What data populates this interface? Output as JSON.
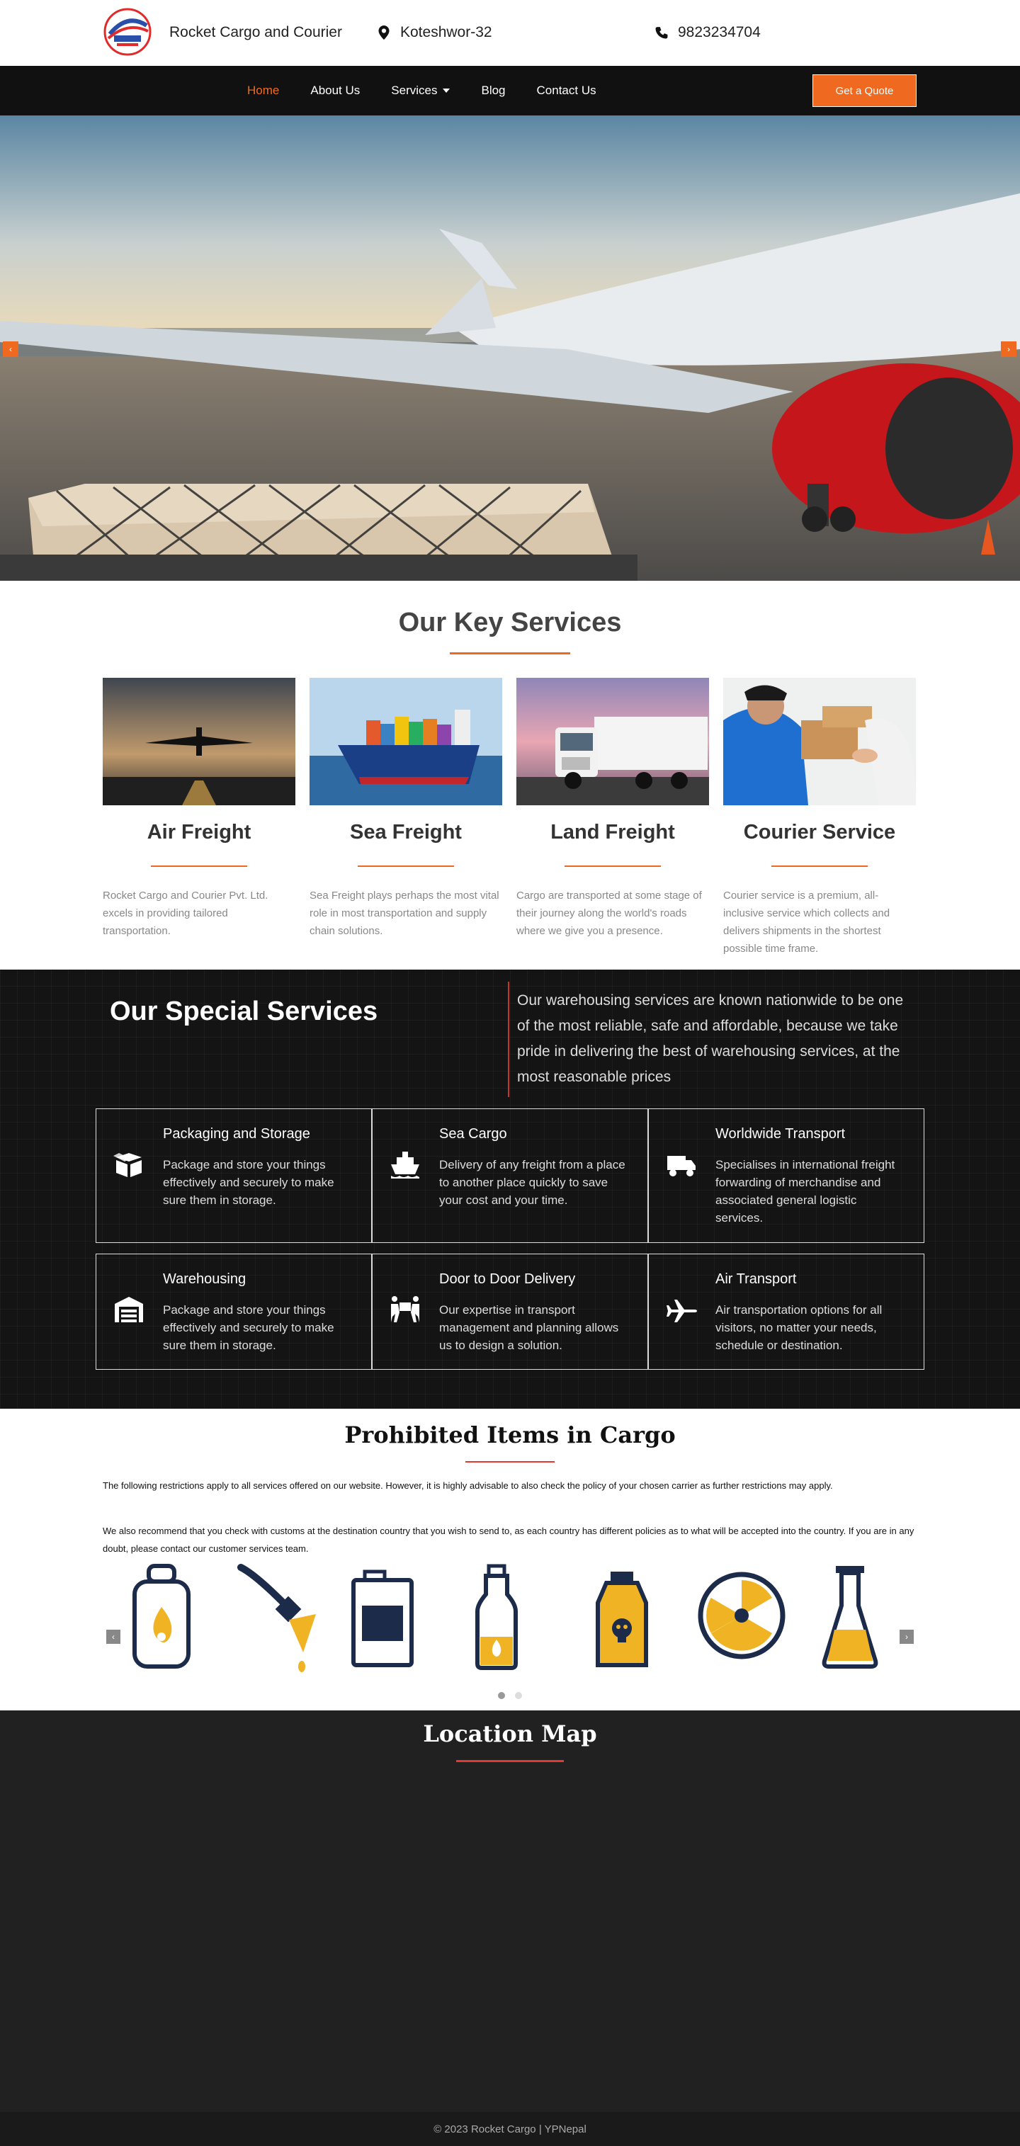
{
  "header": {
    "brand": "Rocket Cargo and Courier",
    "location": "Koteshwor-32",
    "phone": "9823234704"
  },
  "nav": {
    "items": [
      "Home",
      "About Us",
      "Services",
      "Blog",
      "Contact Us"
    ],
    "active": "Home",
    "cta": "Get a Quote"
  },
  "hero": {
    "prev": "‹",
    "next": "›"
  },
  "key_services": {
    "title": "Our Key Services",
    "cards": [
      {
        "title": "Air Freight",
        "text": "Rocket Cargo and Courier Pvt. Ltd. excels in providing tailored transportation."
      },
      {
        "title": "Sea Freight",
        "text": "Sea Freight plays perhaps the most vital role in most transportation and supply chain solutions."
      },
      {
        "title": "Land Freight",
        "text": "Cargo are transported at some stage of their journey along the world's roads where we give you a presence."
      },
      {
        "title": "Courier Service",
        "text": "Courier service is a premium, all-inclusive service which collects and delivers shipments in the shortest possible time frame."
      }
    ]
  },
  "special": {
    "title": "Our Special Services",
    "intro": "Our warehousing services are known nationwide to be one of the most reliable, safe and affordable, because we take pride in delivering the best of warehousing services, at the most reasonable prices",
    "items": [
      {
        "title": "Packaging and Storage",
        "text": "Package and store your things effectively and securely to make sure them in storage.",
        "icon": "box-open-icon"
      },
      {
        "title": "Sea Cargo",
        "text": "Delivery of any freight from a place to another place quickly to save your cost and your time.",
        "icon": "ship-icon"
      },
      {
        "title": "Worldwide Transport",
        "text": "Specialises in international freight forwarding of merchandise and associated general logistic services.",
        "icon": "truck-icon"
      },
      {
        "title": "Warehousing",
        "text": "Package and store your things effectively and securely to make sure them in storage.",
        "icon": "warehouse-icon"
      },
      {
        "title": "Door to Door Delivery",
        "text": "Our expertise in transport management and planning allows us to design a solution.",
        "icon": "people-carry-icon"
      },
      {
        "title": "Air Transport",
        "text": "Air transportation options for all visitors, no matter your needs, schedule or destination.",
        "icon": "plane-icon"
      }
    ]
  },
  "prohibited": {
    "title": "Prohibited Items in Cargo",
    "p1": "The following restrictions apply to all services offered on our website. However, it is highly advisable to also check the policy of your chosen carrier as further restrictions may apply.",
    "p2": "We also recommend that you check with customs at the destination country that you wish to send to, as each country has different policies as to what will be accepted into the country. If you are in any doubt, please contact our customer services team.",
    "icons": [
      "gas-cylinder-icon",
      "paint-brush-icon",
      "paint-can-icon",
      "flammable-bottle-icon",
      "poison-bottle-icon",
      "radioactive-icon",
      "chemical-flask-icon"
    ],
    "prev": "‹",
    "next": "›"
  },
  "map": {
    "title": "Location Map"
  },
  "footer": {
    "text": "© 2023 Rocket Cargo | YPNepal"
  },
  "colors": {
    "accent": "#ef6a20",
    "dark": "#111111",
    "red_line": "#e23a2f",
    "icon_yellow": "#f0b323",
    "icon_navy": "#1d2b4a"
  }
}
